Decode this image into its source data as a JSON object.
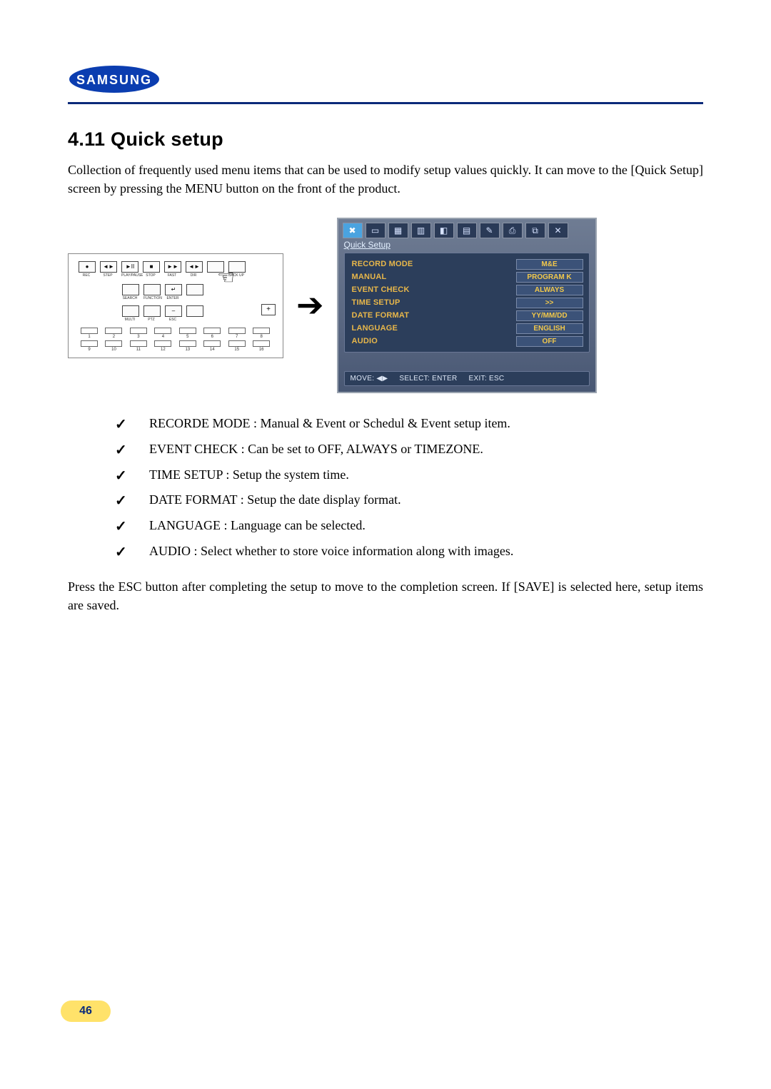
{
  "logo_text": "SAMSUNG",
  "section_title": "4.11 Quick setup",
  "intro": "Collection of frequently used menu items that can be used to modify setup values quickly. It can move to the [Quick Setup] screen by pressing the MENU button on the front of the product.",
  "panel": {
    "row1": [
      {
        "sym": "●",
        "lab": "REC"
      },
      {
        "sym": "◄►",
        "lab": "STEP"
      },
      {
        "sym": "►II",
        "lab": "PLAY/PAUSE"
      },
      {
        "sym": "■",
        "lab": "STOP"
      },
      {
        "sym": "►►",
        "lab": "FAST"
      },
      {
        "sym": "◄►",
        "lab": "DIR"
      },
      {
        "sym": "",
        "lab": ""
      },
      {
        "sym": "",
        "lab": "BACK UP"
      }
    ],
    "row2": [
      {
        "sym": "",
        "lab": "SEARCH"
      },
      {
        "sym": "",
        "lab": "FUNCTION"
      },
      {
        "sym": "↵",
        "lab": "ENTER"
      },
      {
        "sym": "",
        "lab": ""
      }
    ],
    "row3": [
      {
        "sym": "",
        "lab": "MULTI"
      },
      {
        "sym": "",
        "lab": "PTZ"
      },
      {
        "sym": "–",
        "lab": "ESC"
      },
      {
        "sym": "",
        "lab": ""
      }
    ],
    "plus": "+",
    "channels_top": [
      "1",
      "2",
      "3",
      "4",
      "5",
      "6",
      "7",
      "8"
    ],
    "channels_bot": [
      "9",
      "10",
      "11",
      "12",
      "13",
      "14",
      "15",
      "16"
    ]
  },
  "arrow": "➔",
  "dvr": {
    "icons": [
      "✖",
      "▭",
      "▦",
      "▥",
      "◧",
      "▤",
      "✎",
      "⎙",
      "⧉",
      "✕"
    ],
    "title": "Quick Setup",
    "rows": [
      {
        "label": "RECORD MODE",
        "value": "M&E"
      },
      {
        "label": "MANUAL",
        "value": "PROGRAM K"
      },
      {
        "label": "EVENT CHECK",
        "value": "ALWAYS"
      },
      {
        "label": "TIME SETUP",
        "value": ">>"
      },
      {
        "label": "DATE FORMAT",
        "value": "YY/MM/DD"
      },
      {
        "label": "LANGUAGE",
        "value": "ENGLISH"
      },
      {
        "label": "AUDIO",
        "value": "OFF"
      }
    ],
    "foot": {
      "move": "MOVE: ◀▶",
      "select": "SELECT: ENTER",
      "exit": "EXIT: ESC"
    }
  },
  "bullets": [
    "RECORDE MODE : Manual & Event or Schedul & Event setup item.",
    "EVENT CHECK : Can be set to OFF, ALWAYS or TIMEZONE.",
    "TIME SETUP : Setup the system time.",
    "DATE FORMAT : Setup the date display format.",
    "LANGUAGE : Language can be selected.",
    "AUDIO : Select whether to store voice information along with images."
  ],
  "outro": "Press the ESC button after completing the setup to move to the completion screen. If [SAVE] is selected here, setup items are saved.",
  "page_number": "46"
}
